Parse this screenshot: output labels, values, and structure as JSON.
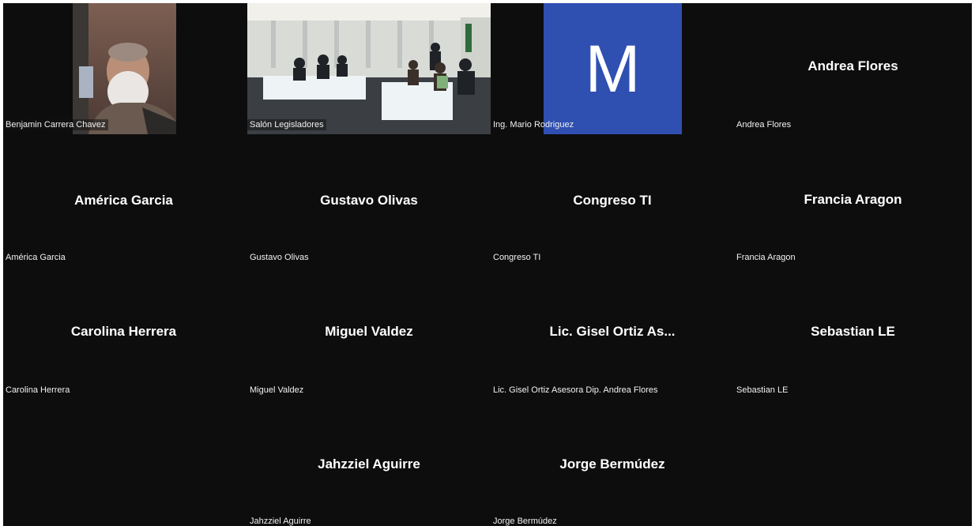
{
  "meeting": {
    "colors": {
      "background": "#0d0d0e",
      "avatar_bg": "#2f4fb1",
      "name_text": "#ffffff"
    },
    "participants": [
      {
        "display": "",
        "label": "Benjamin Carrera Chavez",
        "video": true
      },
      {
        "display": "",
        "label": "Salón Legisladores",
        "video": true
      },
      {
        "display": "M",
        "label": "Ing. Mario Rodriguez",
        "avatar": true
      },
      {
        "display": "Andrea Flores",
        "label": "Andrea Flores"
      },
      {
        "display": "América Garcia",
        "label": "América Garcia"
      },
      {
        "display": "Gustavo Olivas",
        "label": "Gustavo Olivas"
      },
      {
        "display": "Congreso TI",
        "label": "Congreso TI"
      },
      {
        "display": "Francia Aragon",
        "label": "Francia Aragon"
      },
      {
        "display": "Carolina Herrera",
        "label": "Carolina Herrera"
      },
      {
        "display": "Miguel Valdez",
        "label": "Miguel Valdez"
      },
      {
        "display": "Lic. Gisel Ortiz As...",
        "label": "Lic. Gisel Ortiz Asesora Dip. Andrea Flores"
      },
      {
        "display": "Sebastian LE",
        "label": "Sebastian LE"
      },
      {
        "display": "Jahzziel Aguirre",
        "label": "Jahzziel Aguirre"
      },
      {
        "display": "Jorge Bermúdez",
        "label": "Jorge Bermúdez"
      }
    ]
  }
}
